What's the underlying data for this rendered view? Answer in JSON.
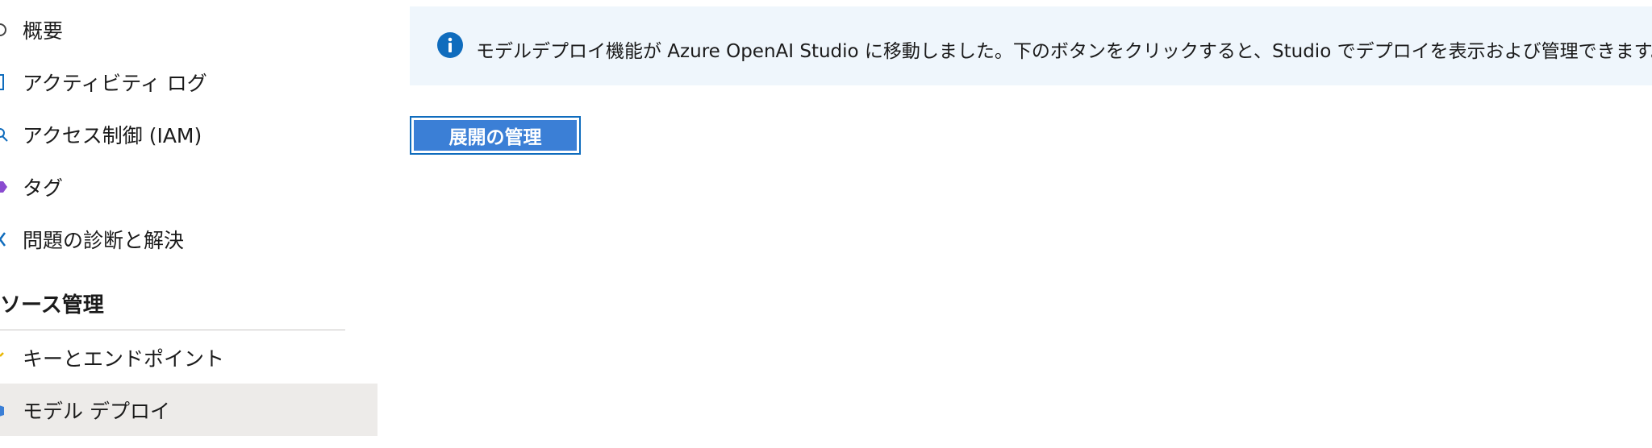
{
  "sidebar": {
    "items": [
      {
        "label": "概要",
        "icon": "overview-icon"
      },
      {
        "label": "アクティビティ ログ",
        "icon": "activity-log-icon"
      },
      {
        "label": "アクセス制御 (IAM)",
        "icon": "access-control-icon"
      },
      {
        "label": "タグ",
        "icon": "tag-icon"
      },
      {
        "label": "問題の診断と解決",
        "icon": "diagnose-icon"
      }
    ],
    "section_title": "ソース管理",
    "section_items": [
      {
        "label": "キーとエンドポイント",
        "icon": "key-icon"
      },
      {
        "label": "モデル デプロイ",
        "icon": "model-deploy-icon",
        "selected": true
      }
    ]
  },
  "main": {
    "info_banner": {
      "icon": "info-icon",
      "text": "モデルデプロイ機能が Azure OpenAI Studio に移動しました。下のボタンをクリックすると、Studio でデプロイを表示および管理できます。"
    },
    "manage_button_label": "展開の管理"
  },
  "colors": {
    "accent": "#0f6cbd",
    "button_fill": "#3b7fd6",
    "banner_bg": "#eff6fc",
    "selected_bg": "#edebe9"
  }
}
